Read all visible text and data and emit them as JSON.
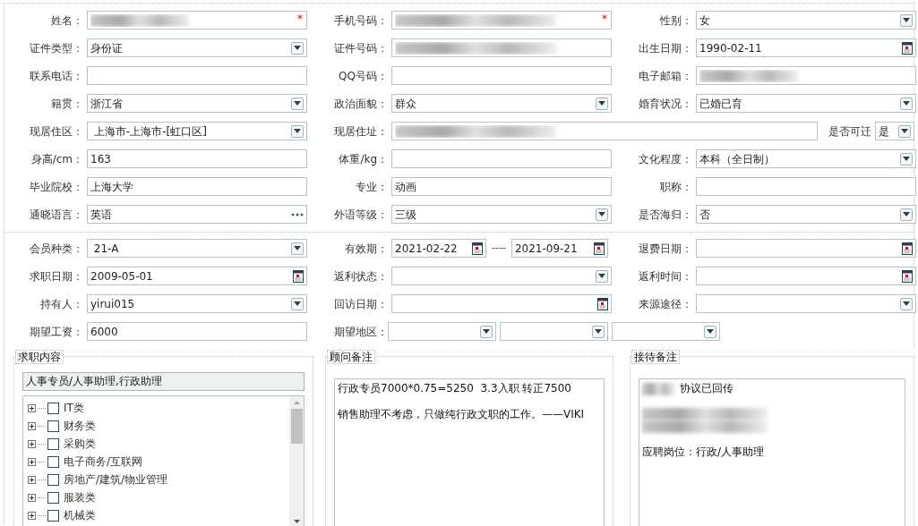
{
  "personal": {
    "rows": [
      [
        {
          "label": "姓名：",
          "field": {
            "kind": "text",
            "redacted": true,
            "required_mark": "*"
          }
        },
        {
          "label": "手机号码：",
          "field": {
            "kind": "text",
            "redacted": true,
            "required_mark": "*"
          }
        },
        {
          "label": "性别：",
          "field": {
            "kind": "select",
            "value": "女"
          }
        }
      ],
      [
        {
          "label": "证件类型：",
          "field": {
            "kind": "select",
            "value": "身份证"
          }
        },
        {
          "label": "证件号码：",
          "field": {
            "kind": "text",
            "redacted": true
          }
        },
        {
          "label": "出生日期：",
          "field": {
            "kind": "date",
            "value": "1990-02-11"
          }
        }
      ],
      [
        {
          "label": "联系电话：",
          "field": {
            "kind": "text"
          }
        },
        {
          "label": "QQ号码：",
          "field": {
            "kind": "text"
          }
        },
        {
          "label": "电子邮箱：",
          "field": {
            "kind": "text",
            "redacted": true
          }
        }
      ],
      [
        {
          "label": "籍贯：",
          "field": {
            "kind": "select",
            "value": "浙江省"
          }
        },
        {
          "label": "政治面貌：",
          "field": {
            "kind": "select",
            "value": "群众"
          }
        },
        {
          "label": "婚育状况：",
          "field": {
            "kind": "select",
            "value": "已婚已育"
          }
        }
      ],
      [
        {
          "label": "现居住区：",
          "field": {
            "kind": "select",
            "value": " 上海市-上海市-[虹口区]"
          }
        },
        {
          "label": "现居住址：",
          "field": {
            "kind": "text",
            "redacted": true
          },
          "extra": {
            "label": "是否可迁",
            "field": {
              "kind": "select",
              "value": "是"
            }
          }
        }
      ],
      [
        {
          "label": "身高/cm：",
          "field": {
            "kind": "text",
            "value": "163"
          }
        },
        {
          "label": "体重/kg：",
          "field": {
            "kind": "text"
          }
        },
        {
          "label": "文化程度：",
          "field": {
            "kind": "select",
            "value": "本科（全日制）"
          }
        }
      ],
      [
        {
          "label": "毕业院校：",
          "field": {
            "kind": "text",
            "value": "上海大学"
          }
        },
        {
          "label": "专业：",
          "field": {
            "kind": "text",
            "value": "动画"
          }
        },
        {
          "label": "职称：",
          "field": {
            "kind": "text"
          }
        }
      ],
      [
        {
          "label": "通晓语言：",
          "field": {
            "kind": "lookup",
            "value": "英语"
          }
        },
        {
          "label": "外语等级：",
          "field": {
            "kind": "select",
            "value": "三级"
          }
        },
        {
          "label": "是否海归：",
          "field": {
            "kind": "select",
            "value": "否"
          }
        }
      ]
    ]
  },
  "membership": {
    "rows": [
      [
        {
          "label": "会员种类：",
          "field": {
            "kind": "select",
            "value": " 21-A"
          }
        },
        {
          "label": "有效期：",
          "field": {
            "kind": "date_range",
            "from": "2021-02-22",
            "separator": "----",
            "to": "2021-09-21"
          }
        },
        {
          "label": "退费日期：",
          "field": {
            "kind": "date"
          }
        }
      ],
      [
        {
          "label": "求职日期：",
          "field": {
            "kind": "date",
            "value": "2009-05-01"
          }
        },
        {
          "label": "返利状态：",
          "field": {
            "kind": "select"
          }
        },
        {
          "label": "返利时间：",
          "field": {
            "kind": "date"
          }
        }
      ],
      [
        {
          "label": "持有人：",
          "field": {
            "kind": "select",
            "value": "yirui015"
          }
        },
        {
          "label": "回访日期：",
          "field": {
            "kind": "date"
          }
        },
        {
          "label": "来源途径：",
          "field": {
            "kind": "select"
          }
        }
      ],
      [
        {
          "label": "期望工资：",
          "field": {
            "kind": "text",
            "value": "6000"
          }
        },
        {
          "label": "期望地区：",
          "field": {
            "kind": "multi_select",
            "parts": [
              {
                "kind": "select"
              },
              {
                "kind": "select"
              },
              {
                "kind": "select"
              }
            ]
          }
        }
      ]
    ]
  },
  "job_content": {
    "title": "求职内容",
    "summary": "人事专员/人事助理,行政助理",
    "categories": [
      {
        "label": "IT类",
        "checked": false,
        "expanded": false
      },
      {
        "label": "财务类",
        "checked": false,
        "expanded": false
      },
      {
        "label": "采购类",
        "checked": false,
        "expanded": false
      },
      {
        "label": "电子商务/互联网",
        "checked": false,
        "expanded": false
      },
      {
        "label": "房地产/建筑/物业管理",
        "checked": false,
        "expanded": false
      },
      {
        "label": "服装类",
        "checked": false,
        "expanded": false
      },
      {
        "label": "机械类",
        "checked": false,
        "expanded": false
      }
    ]
  },
  "consultant_notes": {
    "title": "顾问备注",
    "lines": [
      {
        "text": "行政专员7000*0.75=5250  3.3入职 转正7500"
      },
      {
        "text": "销售助理不考虑，只做纯行政文职的工作。——VIKI"
      }
    ]
  },
  "reception_notes": {
    "title": "接待备注",
    "lines": [
      {
        "redacted": true,
        "text": "协议已回传"
      },
      {
        "redacted": true
      },
      {
        "redacted": true
      },
      {
        "text": "应聘岗位：行政/人事助理"
      }
    ]
  }
}
